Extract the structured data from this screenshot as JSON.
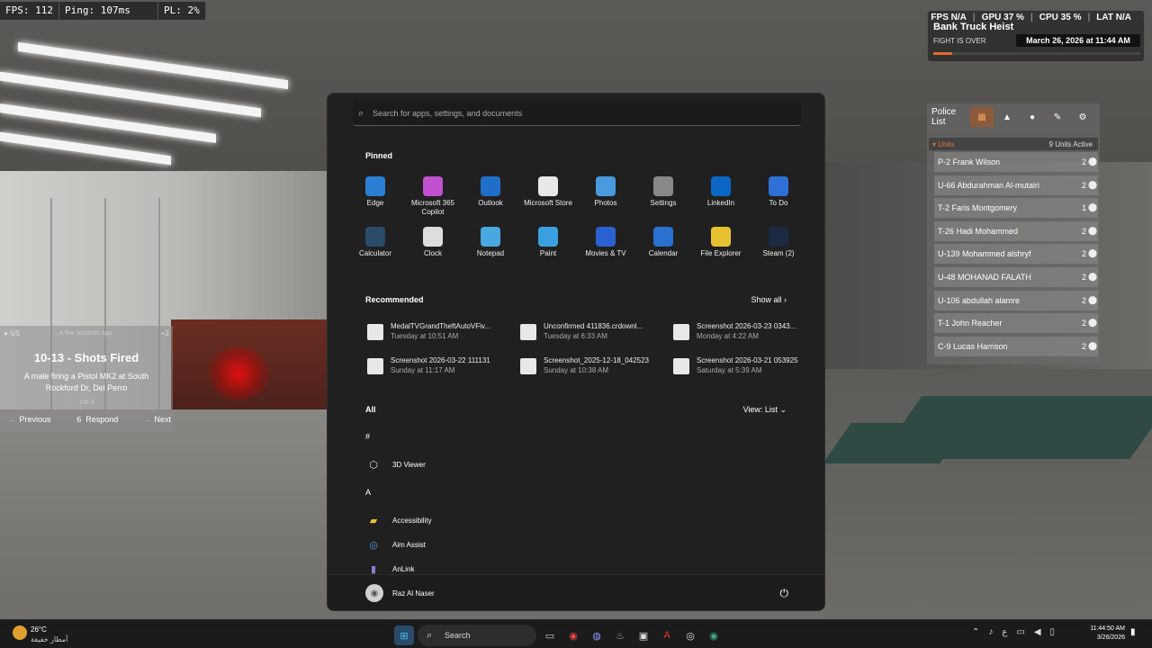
{
  "hud": {
    "fps": "FPS: 112",
    "ping": "Ping: 107ms",
    "pl": "PL: 2%"
  },
  "perf": {
    "fps_label": "FPS",
    "fps_val": "N/A",
    "gpu_label": "GPU",
    "gpu_val": "37 %",
    "cpu_label": "CPU",
    "cpu_val": "35 %",
    "lat_label": "LAT",
    "lat_val": "N/A",
    "heist_title": "Bank Truck Heist",
    "heist_status": "FIGHT IS OVER",
    "heist_date": "March 26, 2026 at 11:44 AM",
    "heist_progress": 0.09,
    "accent": "#e06a30"
  },
  "police": {
    "title_1": "Police",
    "title_2": "List",
    "units_label": "Units",
    "units_active": "9 Units Active",
    "units": [
      {
        "name": "P-2 Frank Wilson",
        "count": "2"
      },
      {
        "name": "U-66 Abdurahman Al-mutairi",
        "count": "2"
      },
      {
        "name": "T-2 Faris Montgomery",
        "count": "1"
      },
      {
        "name": "T-26 Hadi Mohammed",
        "count": "2"
      },
      {
        "name": "U-139 Mohammed alshryf",
        "count": "2"
      },
      {
        "name": "U-48 MOHANAD FALATH",
        "count": "2"
      },
      {
        "name": "U-106 abdullah alamre",
        "count": "2"
      },
      {
        "name": "T-1 John Reacher",
        "count": "2"
      },
      {
        "name": "C-9 Lucas Harrison",
        "count": "2"
      }
    ]
  },
  "alert": {
    "meta": "5/5",
    "ago": "a few seconds ago",
    "num": "2",
    "title": "10-13 - Shots Fired",
    "desc": "A male firing a Pistol MK2 at South Rockford Dr, Del Perro",
    "dist": "106 ft",
    "prev": "Previous",
    "respond_key": "6",
    "respond": "Respond",
    "next": "Next"
  },
  "start": {
    "search_placeholder": "Search for apps, settings, and documents",
    "pinned_label": "Pinned",
    "pinned": [
      {
        "label": "Edge",
        "icon": "edge-icon"
      },
      {
        "label": "Microsoft 365 Copilot",
        "icon": "copilot-icon"
      },
      {
        "label": "Outlook",
        "icon": "outlook-icon"
      },
      {
        "label": "Microsoft Store",
        "icon": "store-icon"
      },
      {
        "label": "Photos",
        "icon": "photos-icon"
      },
      {
        "label": "Settings",
        "icon": "gear-icon"
      },
      {
        "label": "LinkedIn",
        "icon": "linkedin-icon"
      },
      {
        "label": "To Do",
        "icon": "todo-icon"
      },
      {
        "label": "Calculator",
        "icon": "calculator-icon"
      },
      {
        "label": "Clock",
        "icon": "clock-icon"
      },
      {
        "label": "Notepad",
        "icon": "notepad-icon"
      },
      {
        "label": "Paint",
        "icon": "paint-icon"
      },
      {
        "label": "Movies & TV",
        "icon": "movies-icon"
      },
      {
        "label": "Calendar",
        "icon": "calendar-icon"
      },
      {
        "label": "File Explorer",
        "icon": "folder-icon"
      },
      {
        "label": "Steam (2)",
        "icon": "steam-icon"
      }
    ],
    "recommended_label": "Recommended",
    "show_all": "Show all",
    "recommended": [
      {
        "name": "MedalTVGrandTheftAutoVFiv...",
        "time": "Tuesday at 10:51 AM"
      },
      {
        "name": "Unconfirmed 411836.crdownl...",
        "time": "Tuesday at 6:33 AM"
      },
      {
        "name": "Screenshot 2026-03-23 0343...",
        "time": "Monday at 4:22 AM"
      },
      {
        "name": "Screenshot 2026-03-22 111131",
        "time": "Sunday at 11:17 AM"
      },
      {
        "name": "Screenshot_2025-12-18_042523",
        "time": "Sunday at 10:38 AM"
      },
      {
        "name": "Screenshot 2026-03-21 053925",
        "time": "Saturday at 5:39 AM"
      }
    ],
    "all_label": "All",
    "view_label": "View: List",
    "letter_hash": "#",
    "letter_a": "A",
    "apps": [
      {
        "name": "3D Viewer",
        "icon": "cube-icon"
      },
      {
        "name": "Accessibility",
        "icon": "folder-icon"
      },
      {
        "name": "Aim Assist",
        "icon": "aim-icon"
      },
      {
        "name": "AnLink",
        "icon": "anlink-icon"
      }
    ],
    "user": "Raz Al Naser"
  },
  "taskbar": {
    "temp": "26°C",
    "weather_desc": "أمطار خفيفة",
    "search": "Search",
    "time": "11:44:50 AM",
    "date": "3/26/2026"
  }
}
